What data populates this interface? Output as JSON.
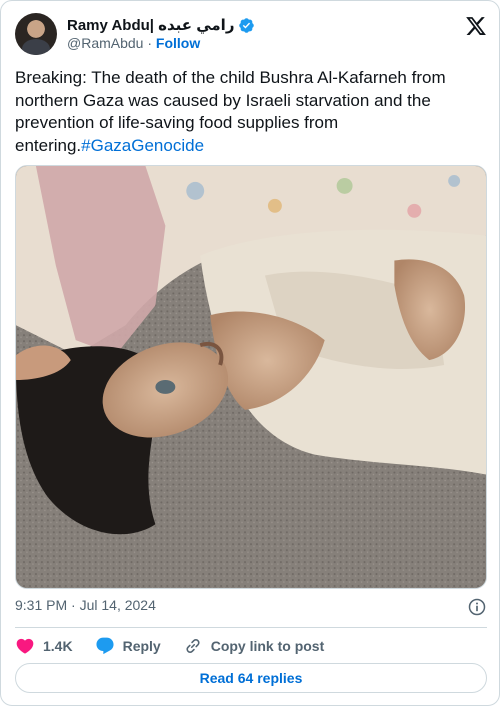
{
  "author": {
    "display_name": "Ramy Abdu| رامي عبده",
    "handle": "@RamAbdu",
    "separator": "·",
    "follow_label": "Follow",
    "verified": true
  },
  "tweet": {
    "text": "Breaking: The death of the child Bushra Al-Kafarneh from northern Gaza was caused by Israeli starvation and the prevention of life-saving food supplies from entering.",
    "hashtag": "#GazaGenocide",
    "timestamp": "9:31 PM · Jul 14, 2024"
  },
  "actions": {
    "like_count": "1.4K",
    "reply_label": "Reply",
    "copy_label": "Copy link to post"
  },
  "read_replies_label": "Read 64 replies",
  "colors": {
    "accent": "#006fd6",
    "like": "#f91880",
    "reply": "#1d9bf0",
    "muted": "#536471",
    "border": "#cfd9de"
  },
  "icons": [
    "x-logo-icon",
    "verified-badge-icon",
    "info-icon",
    "heart-icon",
    "reply-bubble-icon",
    "link-icon"
  ]
}
